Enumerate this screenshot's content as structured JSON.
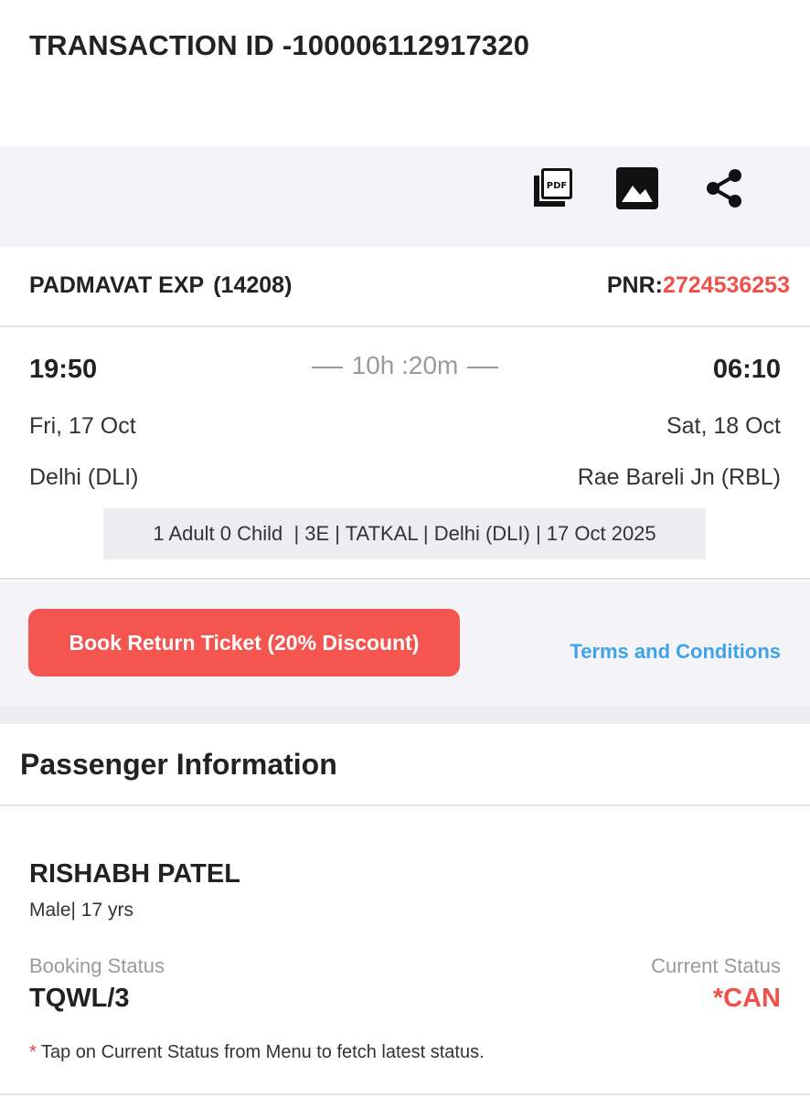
{
  "transaction": {
    "title": "TRANSACTION ID -100006112917320"
  },
  "actions": [
    {
      "icon": "pdf-icon"
    },
    {
      "icon": "image-icon"
    },
    {
      "icon": "share-icon"
    }
  ],
  "train": {
    "name": "PADMAVAT EXP",
    "number": "(14208)",
    "pnr_label": "PNR:",
    "pnr_value": "2724536253"
  },
  "journey": {
    "departure": {
      "time": "19:50",
      "date": "Fri, 17 Oct",
      "station": "Delhi (DLI)"
    },
    "arrival": {
      "time": "06:10",
      "date": "Sat, 18 Oct",
      "station": "Rae Bareli Jn (RBL)"
    },
    "duration": "10h :20m",
    "summary": "1 Adult 0 Child  | 3E | TATKAL | Delhi (DLI) | 17 Oct 2025"
  },
  "booking": {
    "return_button": "Book Return Ticket (20% Discount)",
    "terms_link": "Terms and Conditions"
  },
  "passenger_section": {
    "title": "Passenger Information"
  },
  "passenger": {
    "name": "RISHABH PATEL",
    "meta": "Male| 17 yrs",
    "booking_status_label": "Booking Status",
    "booking_status": "TQWL/3",
    "current_status_label": "Current Status",
    "current_status": "*CAN",
    "note_star": "*",
    "note": " Tap on Current Status from Menu to fetch latest status."
  },
  "colors": {
    "accent_red": "#f0504a",
    "button_red": "#f5554f",
    "link_blue": "#3ea3e8",
    "panel_bg": "#f4f4f8"
  }
}
